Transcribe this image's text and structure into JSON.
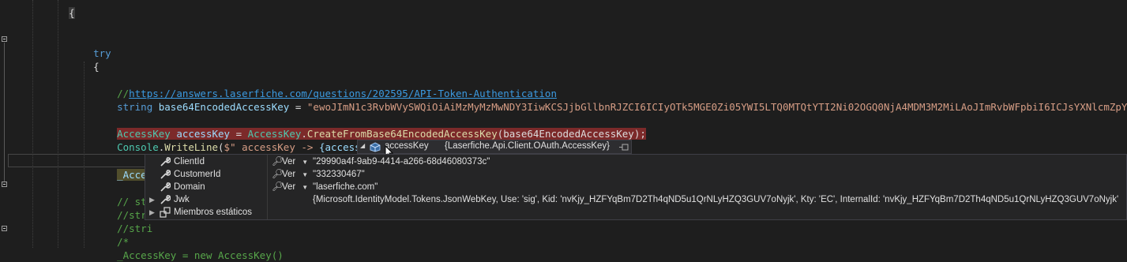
{
  "editor": {
    "lines": {
      "l0": "{",
      "l_try": "try",
      "l_brace": "{",
      "l_cmt_prefix": "//",
      "l_cmt_url": "https://answers.laserfiche.com/questions/202595/API-Token-Authentication",
      "l_str_type": "string",
      "l_str_var": "base64EncodedAccessKey",
      "l_str_eq": " = ",
      "l_str_val": "\"ewoJImN1c3RvbWVySWQiOiAiMzMyMzMwNDY3IiwKCSJjbGllbnRJZCI6ICIyOTk5MGE0Zi05YWI5LTQ0MTQtYTI2Ni02OGQ0NjA4MDM3M2MiLAoJImRvbWFpbiI6ICJsYXNlcmZpY",
      "l_ak_type": "AccessKey",
      "l_ak_var": "accessKey",
      "l_ak_eq": " = ",
      "l_ak_cls": "AccessKey",
      "l_ak_dot": ".",
      "l_ak_mth": "CreateFromBase64EncodedAccessKey",
      "l_ak_arg": "(base64EncodedAccessKey);",
      "l_cw_cls": "Console",
      "l_cw_dot": ".",
      "l_cw_mth": "WriteLine",
      "l_cw_open": "(",
      "l_cw_str1": "$\" accessKey -> ",
      "l_cw_interp": "{accessKey}",
      "l_cw_str2": "\"",
      "l_cw_close": ");",
      "l_cur": "_Access",
      "l_c1": "// stri",
      "l_c2": "//stri",
      "l_c3": "//stri",
      "l_c4": "/*",
      "l_last": "_AccessKey = new AccessKey()"
    }
  },
  "datatip": {
    "header": {
      "expander": "◢",
      "name": "accessKey",
      "type": "{Laserfiche.Api.Client.OAuth.AccessKey}",
      "pin_icon": "pin-icon"
    },
    "rows": [
      {
        "name": "ClientId",
        "ver": "Ver",
        "value": "\"29990a4f-9ab9-4414-a266-68d46080373c\""
      },
      {
        "name": "CustomerId",
        "ver": "Ver",
        "value": "\"332330467\""
      },
      {
        "name": "Domain",
        "ver": "Ver",
        "value": "\"laserfiche.com\""
      },
      {
        "name": "Jwk",
        "ver": "",
        "value": "{Microsoft.IdentityModel.Tokens.JsonWebKey, Use: 'sig',  Kid: 'nvKjy_HZFYqBm7D2Th4qND5u1QrNLyHZQ3GUV7oNyjk', Kty: 'EC', InternalId: 'nvKjy_HZFYqBm7D2Th4qND5u1QrNLyHZQ3GUV7oNyjk'"
      },
      {
        "name": "Miembros estáticos",
        "ver": "",
        "value": ""
      }
    ],
    "icons": {
      "property": "wrench-icon",
      "static": "static-members-icon",
      "search": "magnifier-icon",
      "dropdown": "chevron-down-icon"
    }
  },
  "colors": {
    "background": "#1e1e1e",
    "keyword": "#569cd6",
    "string": "#d69d85",
    "comment": "#57a64a",
    "breakpoint_highlight": "#7c2a2a",
    "tooltip_bg": "#252526"
  }
}
